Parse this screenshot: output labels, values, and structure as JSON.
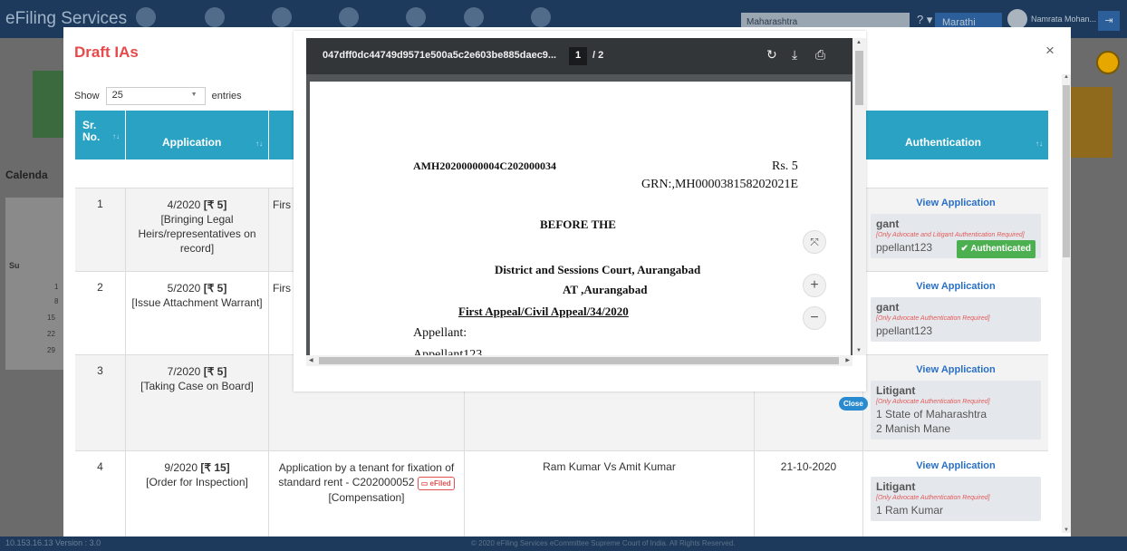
{
  "app": {
    "brand": "eFiling Services",
    "state_select": "Maharashtra",
    "help_label": "? ▾",
    "language": "Marathi",
    "user": "Namrata Mohan...",
    "version": "10.153.16.13  Version : 3.0",
    "copyright": "© 2020 eFiling Services eCommittee Supreme Court of India. All Rights Reserved.",
    "calendar_label": "Calenda",
    "calendar_day_header": "Su",
    "calendar_dates": [
      "1",
      "8",
      "15",
      "22",
      "29"
    ]
  },
  "colors": {
    "header_bg": "#1d3a5c",
    "table_header": "#29a2c4",
    "title_red": "#e74a4a",
    "authenticated_green": "#4caf50",
    "link_blue": "#2a70c6"
  },
  "modal": {
    "title": "Draft IAs",
    "close_icon": "×",
    "show_label": "Show",
    "entries_value": "25",
    "entries_label": "entries",
    "columns": {
      "sr_no": "Sr. No.",
      "application": "Application",
      "authentication": "Authentication"
    },
    "rows": [
      {
        "sr": "1",
        "app_no": "4/2020",
        "fee": "[₹ 5]",
        "app_type": "[Bringing Legal Heirs/representatives on record]",
        "particulars": "Firs",
        "view": "View Application",
        "lit_title": "gant",
        "lit_note": "[Only Advocate and Litigant Authentication Required]",
        "lit_names": [
          "ppellant123"
        ],
        "badge": "✔ Authenticated"
      },
      {
        "sr": "2",
        "app_no": "5/2020",
        "fee": "[₹ 5]",
        "app_type": "[Issue Attachment Warrant]",
        "particulars": "Firs",
        "view": "View Application",
        "lit_title": "gant",
        "lit_note": "[Only Advocate Authentication Required]",
        "lit_names": [
          "ppellant123"
        ]
      },
      {
        "sr": "3",
        "app_no": "7/2020",
        "fee": "[₹ 5]",
        "app_type": "[Taking Case on Board]",
        "view": "View Application",
        "lit_title": "Litigant",
        "lit_note": "[Only Advocate Authentication Required]",
        "lit_names": [
          "1 State of Maharashtra",
          "2 Manish Mane"
        ]
      },
      {
        "sr": "4",
        "app_no": "9/2020",
        "fee": "[₹ 15]",
        "app_type": "[Order for Inspection]",
        "particulars": "Application by a tenant for fixation of standard rent - C202000052",
        "efiled": "eFiled",
        "particulars2": "[Compensation]",
        "parties": "Ram Kumar Vs Amit Kumar",
        "date": "21-10-2020",
        "view": "View Application",
        "lit_title": "Litigant",
        "lit_note": "[Only Advocate Authentication Required]",
        "lit_names": [
          "1 Ram Kumar"
        ]
      }
    ],
    "close_pill": "Close"
  },
  "pdf": {
    "filename": "047dff0dc44749d9571e500a5c2e603be885daec9...",
    "page_current": "1",
    "page_total": "/  2",
    "rotate_icon": "↻",
    "download_icon": "⤓",
    "print_icon": "⎙",
    "doc_id": "AMH20200000004C202000034",
    "amount": "Rs. 5",
    "grn": "GRN:,MH000038158202021E",
    "before": "BEFORE THE",
    "court": "District and Sessions Court, Aurangabad",
    "at": "AT ,Aurangabad",
    "case": "First Appeal/Civil Appeal/34/2020",
    "appellant_label": "Appellant:",
    "appellant_partial": "Appellant123",
    "fit_icon": "⤧",
    "zoom_in_icon": "+",
    "zoom_out_icon": "−"
  }
}
